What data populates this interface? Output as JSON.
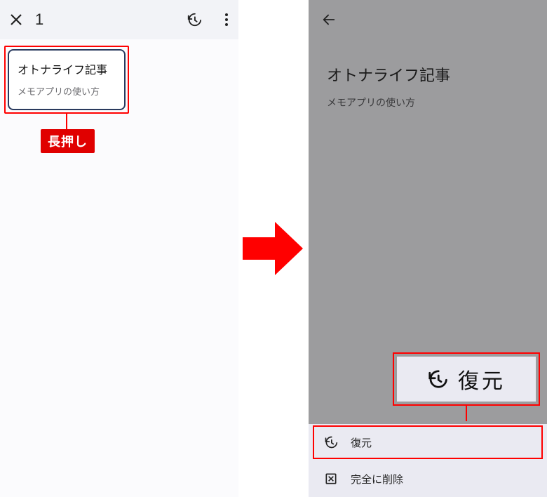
{
  "left": {
    "selected_count": "1",
    "card": {
      "title": "オトナライフ記事",
      "body": "メモアプリの使い方"
    }
  },
  "annotation": {
    "long_press": "長押し"
  },
  "right": {
    "note": {
      "title": "オトナライフ記事",
      "body": "メモアプリの使い方"
    },
    "callout": {
      "label": "復元"
    },
    "menu": {
      "restore": "復元",
      "delete": "完全に削除"
    }
  }
}
